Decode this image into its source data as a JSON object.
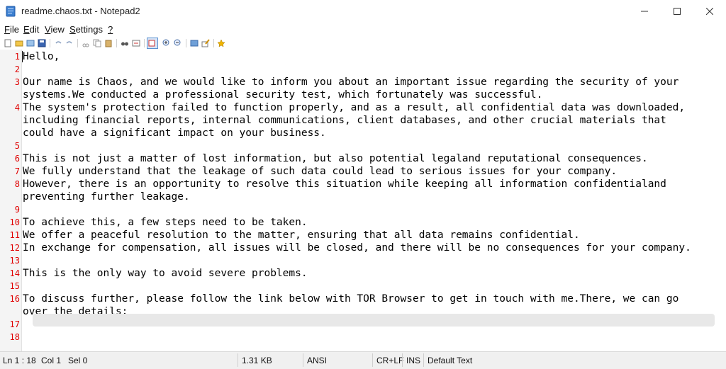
{
  "window": {
    "title": "readme.chaos.txt - Notepad2",
    "app_icon": "notepad-icon",
    "controls": [
      "minimize-icon",
      "maximize-icon",
      "close-icon"
    ]
  },
  "menu": {
    "items": [
      {
        "key": "F",
        "rest": "ile"
      },
      {
        "key": "E",
        "rest": "dit"
      },
      {
        "key": "V",
        "rest": "iew"
      },
      {
        "key": "S",
        "rest": "ettings"
      },
      {
        "key": "?",
        "rest": ""
      }
    ]
  },
  "toolbar": {
    "icons": [
      "new-file-icon",
      "open-file-icon",
      "browse-icon",
      "save-icon",
      "undo-icon",
      "redo-icon",
      "cut-icon",
      "copy-icon",
      "paste-icon",
      "find-icon",
      "replace-icon",
      "word-wrap-icon",
      "zoom-in-icon",
      "zoom-out-icon",
      "scheme-icon",
      "customize-icon",
      "favorites-icon"
    ]
  },
  "editor": {
    "lines": [
      {
        "num": "1",
        "text": "Hello,"
      },
      {
        "num": "2",
        "text": ""
      },
      {
        "num": "3",
        "text": "Our name is Chaos, and we would like to inform you about an important issue regarding the security of your"
      },
      {
        "num": "",
        "text": "systems.We conducted a professional security test, which fortunately was successful."
      },
      {
        "num": "4",
        "text": "The system's protection failed to function properly, and as a result, all confidential data was downloaded,"
      },
      {
        "num": "",
        "text": "including financial reports, internal communications, client databases, and other crucial materials that"
      },
      {
        "num": "",
        "text": "could have a significant impact on your business."
      },
      {
        "num": "5",
        "text": ""
      },
      {
        "num": "6",
        "text": "This is not just a matter of lost information, but also potential legaland reputational consequences."
      },
      {
        "num": "7",
        "text": "We fully understand that the leakage of such data could lead to serious issues for your company."
      },
      {
        "num": "8",
        "text": "However, there is an opportunity to resolve this situation while keeping all information confidentialand"
      },
      {
        "num": "",
        "text": "preventing further leakage."
      },
      {
        "num": "9",
        "text": ""
      },
      {
        "num": "10",
        "text": "To achieve this, a few steps need to be taken."
      },
      {
        "num": "11",
        "text": "We offer a peaceful resolution to the matter, ensuring that all data remains confidential."
      },
      {
        "num": "12",
        "text": "In exchange for compensation, all issues will be closed, and there will be no consequences for your company."
      },
      {
        "num": "13",
        "text": ""
      },
      {
        "num": "14",
        "text": "This is the only way to avoid severe problems."
      },
      {
        "num": "15",
        "text": ""
      },
      {
        "num": "16",
        "text": "To discuss further, please follow the link below with TOR Browser to get in touch with me.There, we can go"
      },
      {
        "num": "",
        "text": "over the details:"
      },
      {
        "num": "17",
        "text": ""
      },
      {
        "num": "18",
        "text": ""
      }
    ]
  },
  "status": {
    "position": "Ln 1 : 18",
    "col": "Col 1",
    "sel": "Sel 0",
    "size": "1.31 KB",
    "encoding": "ANSI",
    "eol": "CR+LF",
    "ins": "INS",
    "scheme": "Default Text"
  }
}
